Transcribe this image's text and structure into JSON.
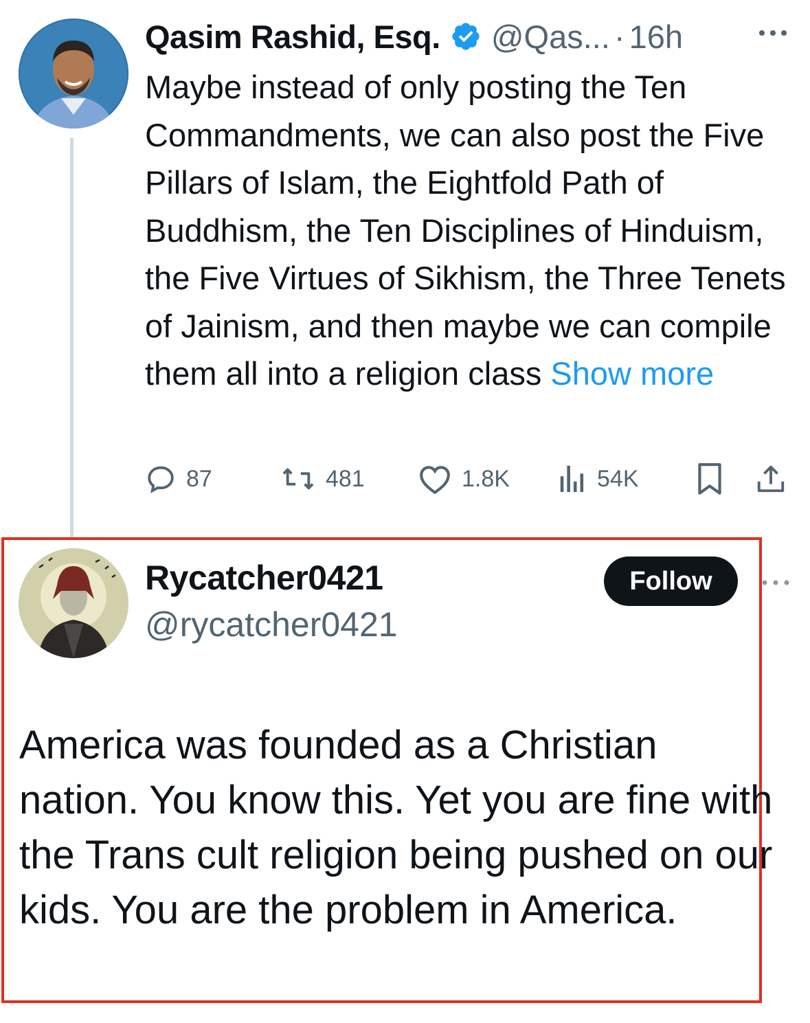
{
  "tweet": {
    "author_name": "Qasim Rashid, Esq.",
    "verified_icon": "verified-badge-icon",
    "handle": "@Qas...",
    "separator": "·",
    "time": "16h",
    "text": "Maybe instead of only posting the Ten Commandments, we can also post the Five Pillars of Islam, the Eightfold Path of Buddhism, the Ten Disciplines of Hinduism, the Five Virtues of Sikhism, the Three Tenets of Jainism, and then maybe we can compile them all into a religion class",
    "show_more": "Show more",
    "stats": {
      "replies": "87",
      "reposts": "481",
      "likes": "1.8K",
      "views": "54K"
    }
  },
  "reply": {
    "author_name": "Rycatcher0421",
    "handle": "@rycatcher0421",
    "follow_label": "Follow",
    "text": "America was founded as a Christian nation. You know this. Yet you are fine with the Trans cult religion being pushed on our kids. You are the problem in America."
  },
  "colors": {
    "text": "#0f1419",
    "secondary": "#536471",
    "link": "#1d9bf0",
    "highlight_border": "#e0301e",
    "follow_bg": "#0f1419"
  }
}
